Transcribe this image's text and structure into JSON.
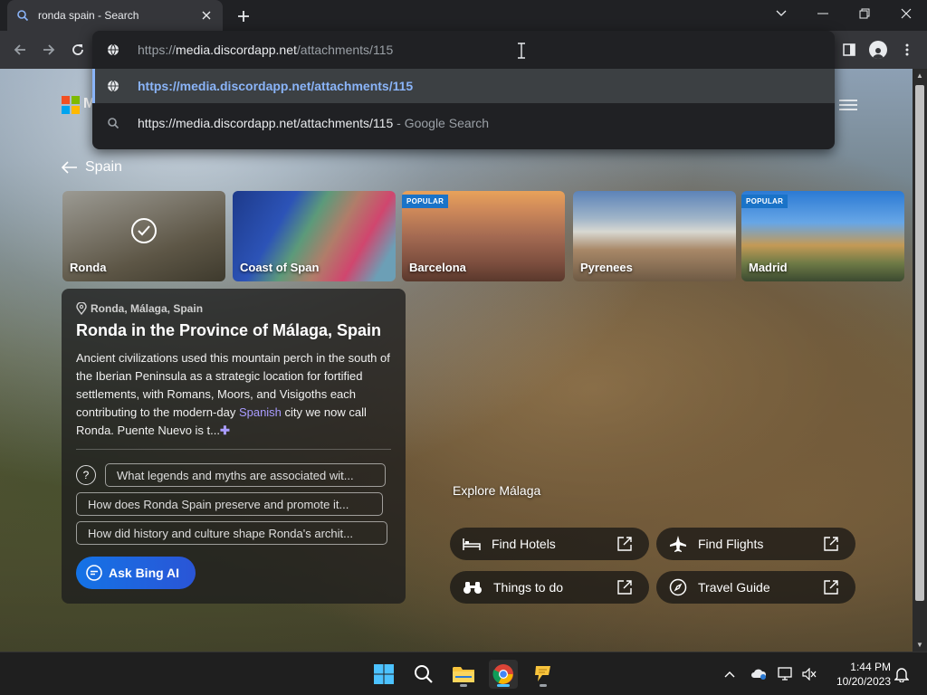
{
  "browser": {
    "tab_title": "ronda spain - Search",
    "omnibox": {
      "scheme": "https://",
      "host": "media.discordapp.net",
      "path": "/attachments/115",
      "suggestions": [
        {
          "text": "https://media.discordapp.net/attachments/115",
          "suffix": ""
        },
        {
          "text": "https://media.discordapp.net/attachments/115",
          "suffix": " - Google Search"
        }
      ]
    }
  },
  "page": {
    "brand_letter": "M",
    "back_label": "Spain",
    "cards": [
      {
        "name": "Ronda",
        "badge": "",
        "selected": true
      },
      {
        "name": "Coast of Span",
        "badge": "",
        "selected": false
      },
      {
        "name": "Barcelona",
        "badge": "POPULAR",
        "selected": false
      },
      {
        "name": "Pyrenees",
        "badge": "",
        "selected": false
      },
      {
        "name": "Madrid",
        "badge": "POPULAR",
        "selected": false
      }
    ],
    "info": {
      "location": "Ronda, Málaga, Spain",
      "title": "Ronda in the Province of Málaga, Spain",
      "description_before_link": "Ancient civilizations used this mountain perch in the south of the Iberian Peninsula as a strategic location for fortified settlements, with Romans, Moors, and Visigoths each contributing to the modern-day ",
      "description_link": "Spanish",
      "description_after_link": " city we now call Ronda. Puente Nuevo is t...",
      "more_glyph": "✚",
      "questions": [
        "What legends and myths are associated wit...",
        "How does Ronda Spain preserve and promote it...",
        "How did history and culture shape Ronda's archit..."
      ],
      "ask_label": "Ask Bing AI"
    },
    "explore": {
      "title": "Explore Málaga",
      "buttons": [
        {
          "label": "Find Hotels",
          "icon": "bed-icon"
        },
        {
          "label": "Find Flights",
          "icon": "airplane-icon"
        },
        {
          "label": "Things to do",
          "icon": "binoculars-icon"
        },
        {
          "label": "Travel Guide",
          "icon": "compass-icon"
        }
      ]
    }
  },
  "taskbar": {
    "time": "1:44 PM",
    "date": "10/20/2023"
  },
  "colors": {
    "accent_blue": "#8ab4f8",
    "bing_button": "#1473e6",
    "link_purple": "#a99cff",
    "popular_badge": "#1a73c8"
  }
}
